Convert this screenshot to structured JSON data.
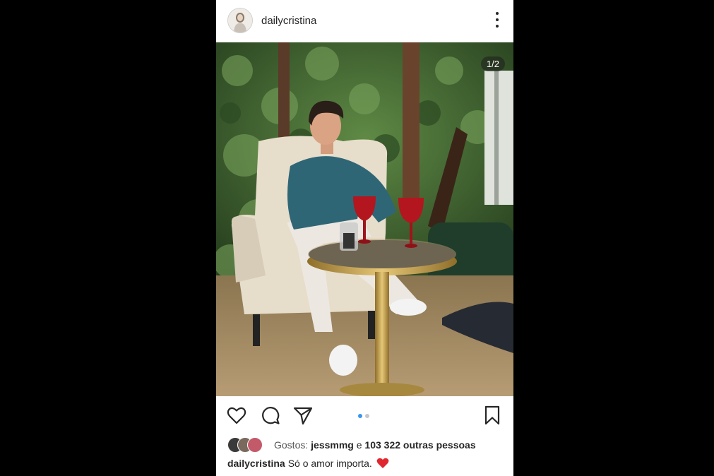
{
  "header": {
    "username": "dailycristina",
    "avatar_icon": "profile-avatar",
    "more_icon": "more-vertical-icon"
  },
  "photo": {
    "counter": "1/2",
    "description_colors": {
      "foliage": "#3c5b2e",
      "sweater": "#2f6676",
      "gold": "#c9a24a",
      "wine": "#b3161e"
    }
  },
  "actions": {
    "like_icon": "heart-icon",
    "comment_icon": "comment-icon",
    "share_icon": "send-icon",
    "save_icon": "bookmark-icon",
    "carousel_pages": 2,
    "carousel_active_index": 0,
    "active_dot_color": "#3897f0",
    "inactive_dot_color": "#c7c7c7"
  },
  "likes": {
    "prefix": "Gostos:",
    "first_liker": "jessmmg",
    "connector": "e",
    "others": "103 322 outras pessoas"
  },
  "caption": {
    "username": "dailycristina",
    "text": "Só o amor importa.",
    "emoji_icon": "red-heart-emoji"
  }
}
